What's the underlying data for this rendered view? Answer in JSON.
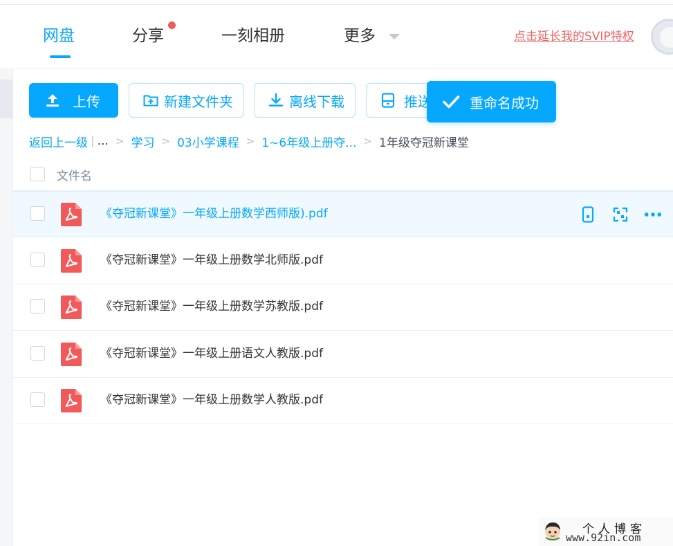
{
  "nav": {
    "tabs": [
      {
        "label": "网盘",
        "active": true
      },
      {
        "label": "分享",
        "active": false,
        "badge": true
      },
      {
        "label": "一刻相册",
        "active": false
      },
      {
        "label": "更多",
        "active": false
      }
    ],
    "svip_link": "点击延长我的SVIP特权"
  },
  "toolbar": {
    "upload_label": "上传",
    "new_folder_label": "新建文件夹",
    "offline_download_label": "离线下载",
    "push_label": "推送"
  },
  "toast": {
    "message": "重命名成功"
  },
  "breadcrumb": {
    "back_label": "返回上一级",
    "bar": "|",
    "ellipsis": "...",
    "sep": ">",
    "items": [
      "学习",
      "03小学课程",
      "1~6年级上册夺..."
    ],
    "current": "1年级夺冠新课堂"
  },
  "list": {
    "header_label": "文件名",
    "files": [
      {
        "name": "《夺冠新课堂》一年级上册数学西师版).pdf",
        "type": "pdf",
        "hovered": true
      },
      {
        "name": "《夺冠新课堂》一年级上册数学北师版.pdf",
        "type": "pdf",
        "hovered": false
      },
      {
        "name": "《夺冠新课堂》一年级上册数学苏教版.pdf",
        "type": "pdf",
        "hovered": false
      },
      {
        "name": "《夺冠新课堂》一年级上册语文人教版.pdf",
        "type": "pdf",
        "hovered": false
      },
      {
        "name": "《夺冠新课堂》一年级上册数学人教版.pdf",
        "type": "pdf",
        "hovered": false
      }
    ],
    "row_actions": [
      "phone-transfer-icon",
      "qr-share-icon",
      "more-icon"
    ]
  },
  "watermark": {
    "title": "个人博客",
    "url": "www.92in.com"
  },
  "colors": {
    "accent": "#06a7ff",
    "svip": "#f06262",
    "pdf": "#f25a5a",
    "badge": "#f25a5a"
  }
}
